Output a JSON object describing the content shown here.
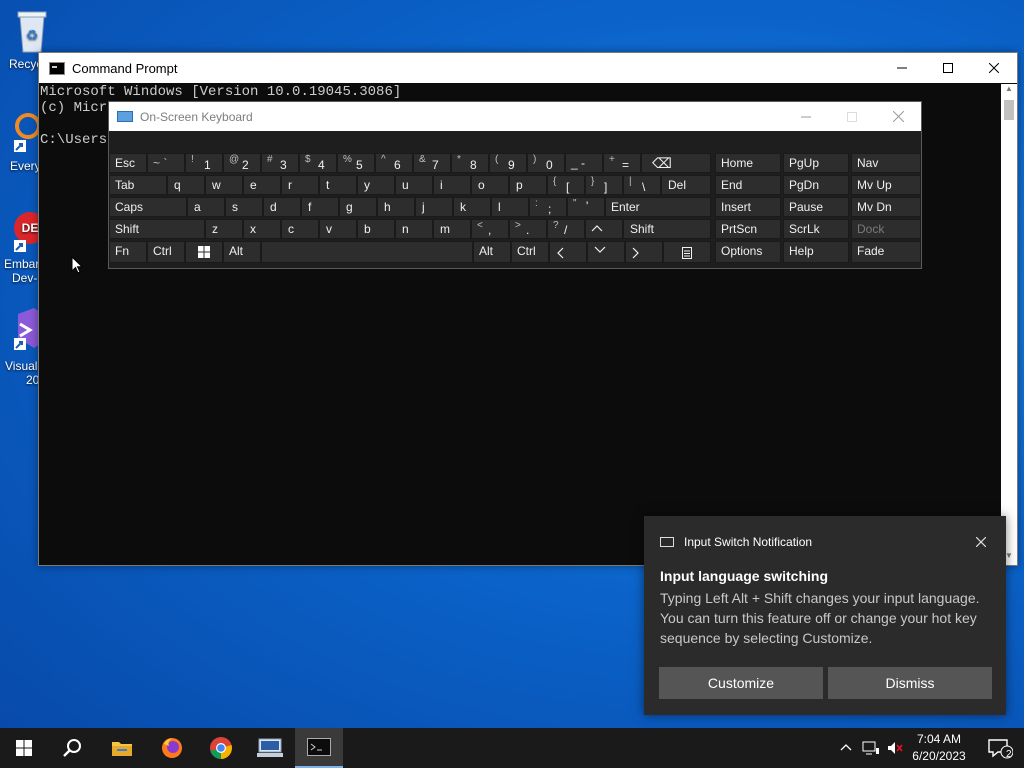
{
  "desktop": {
    "icons": [
      {
        "label": "Recyc"
      },
      {
        "label": "Every"
      },
      {
        "label": "Embar",
        "label2": "Dev-"
      },
      {
        "label": "Visual",
        "label2": "20"
      }
    ]
  },
  "cmd": {
    "title": "Command Prompt",
    "line1": "Microsoft Windows [Version 10.0.19045.3086]",
    "line2": "(c) Micro",
    "line3": "C:\\Users\\"
  },
  "osk": {
    "title": "On-Screen Keyboard",
    "keys": {
      "esc": "Esc",
      "tilde_s": "~ `",
      "k1s": "!",
      "k1": "1",
      "k2s": "@",
      "k2": "2",
      "k3s": "#",
      "k3": "3",
      "k4s": "$",
      "k4": "4",
      "k5s": "%",
      "k5": "5",
      "k6s": "^",
      "k6": "6",
      "k7s": "&",
      "k7": "7",
      "k8s": "*",
      "k8": "8",
      "k9s": "(",
      "k9": "9",
      "k0s": ")",
      "k0": "0",
      "minus": "_ -",
      "plus_s": "+",
      "plus": "=",
      "backspace": "⌫",
      "tab": "Tab",
      "q": "q",
      "w": "w",
      "e": "e",
      "r": "r",
      "t": "t",
      "y": "y",
      "u": "u",
      "i": "i",
      "o": "o",
      "p": "p",
      "lbr_s": "{",
      "lbr": "[",
      "rbr_s": "}",
      "rbr": "]",
      "pipe_s": "|",
      "pipe": "\\",
      "del": "Del",
      "caps": "Caps",
      "a": "a",
      "s": "s",
      "d": "d",
      "f": "f",
      "g": "g",
      "h": "h",
      "j": "j",
      "k": "k",
      "l": "l",
      "semi_s": ":",
      "semi": ";",
      "quote_s": "\"",
      "quote": "'",
      "enter": "Enter",
      "shift": "Shift",
      "z": "z",
      "x": "x",
      "c": "c",
      "v": "v",
      "b": "b",
      "n": "n",
      "m": "m",
      "comma_s": "<",
      "comma": ",",
      "period_s": ">",
      "period": ".",
      "slash_s": "?",
      "slash": "/",
      "up": "^",
      "shift_r": "Shift",
      "fn": "Fn",
      "ctrl": "Ctrl",
      "alt": "Alt",
      "alt_r": "Alt",
      "ctrl_r": "Ctrl",
      "left": "<",
      "down": "v",
      "right": ">",
      "home": "Home",
      "pgup": "PgUp",
      "nav": "Nav",
      "end": "End",
      "pgdn": "PgDn",
      "mvup": "Mv Up",
      "insert": "Insert",
      "pause": "Pause",
      "mvdn": "Mv Dn",
      "prtscn": "PrtScn",
      "scrlk": "ScrLk",
      "dock": "Dock",
      "options": "Options",
      "help": "Help",
      "fade": "Fade"
    }
  },
  "notification": {
    "header": "Input Switch Notification",
    "title": "Input language switching",
    "message": "Typing Left Alt + Shift changes your input language. You can turn this feature off or change your hot key sequence by selecting Customize.",
    "customize": "Customize",
    "dismiss": "Dismiss"
  },
  "taskbar": {
    "time": "7:04 AM",
    "date": "6/20/2023",
    "notif_count": "2"
  },
  "colors": {
    "desktop": "#0b63c9",
    "accent": "#7eb4ea"
  }
}
